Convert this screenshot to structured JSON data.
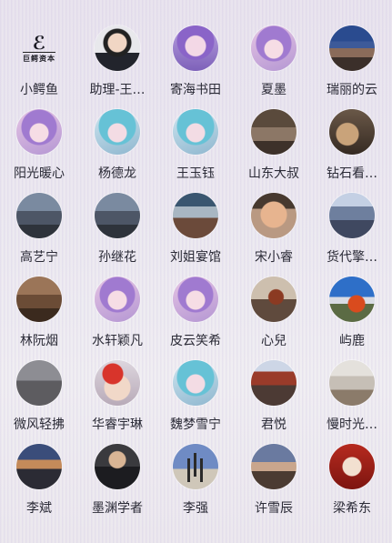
{
  "logo": {
    "mark": "ℰ",
    "text": "巨鳄资本"
  },
  "contacts": [
    {
      "name": "小鳄鱼",
      "avatar": "logo-icon"
    },
    {
      "name": "助理-王…",
      "avatar": "person-avatar"
    },
    {
      "name": "寄海书田",
      "avatar": "anime-avatar"
    },
    {
      "name": "夏墨",
      "avatar": "anime-avatar"
    },
    {
      "name": "瑞丽的云",
      "avatar": "city-photo-avatar"
    },
    {
      "name": "阳光暖心",
      "avatar": "anime-avatar"
    },
    {
      "name": "杨德龙",
      "avatar": "anime-avatar"
    },
    {
      "name": "王玉钰",
      "avatar": "anime-avatar"
    },
    {
      "name": "山东大叔",
      "avatar": "room-photo-avatar"
    },
    {
      "name": "钻石看…",
      "avatar": "food-photo-avatar"
    },
    {
      "name": "高艺宁",
      "avatar": "street-photo-avatar"
    },
    {
      "name": "孙继花",
      "avatar": "street-photo-avatar"
    },
    {
      "name": "刘姐宴馆",
      "avatar": "hall-photo-avatar"
    },
    {
      "name": "宋小睿",
      "avatar": "face-avatar"
    },
    {
      "name": "货代擎…",
      "avatar": "store-photo-avatar"
    },
    {
      "name": "林阮烟",
      "avatar": "wood-photo-avatar"
    },
    {
      "name": "水轩颖凡",
      "avatar": "anime-avatar"
    },
    {
      "name": "皮云笑希",
      "avatar": "anime-avatar"
    },
    {
      "name": "心兒",
      "avatar": "glass-photo-avatar"
    },
    {
      "name": "屿鹿",
      "avatar": "sky-photo-avatar"
    },
    {
      "name": "微风轻拂",
      "avatar": "pipe-photo-avatar"
    },
    {
      "name": "华睿宇琳",
      "avatar": "xmas-avatar"
    },
    {
      "name": "魏梦雪宁",
      "avatar": "anime-avatar"
    },
    {
      "name": "君悦",
      "avatar": "tower-photo-avatar"
    },
    {
      "name": "慢时光…",
      "avatar": "gate-photo-avatar"
    },
    {
      "name": "李斌",
      "avatar": "sunset-photo-avatar"
    },
    {
      "name": "墨渊学者",
      "avatar": "suit-avatar"
    },
    {
      "name": "李强",
      "avatar": "cross-photo-avatar"
    },
    {
      "name": "许雪辰",
      "avatar": "dusk-photo-avatar"
    },
    {
      "name": "梁希东",
      "avatar": "red-avatar"
    }
  ]
}
